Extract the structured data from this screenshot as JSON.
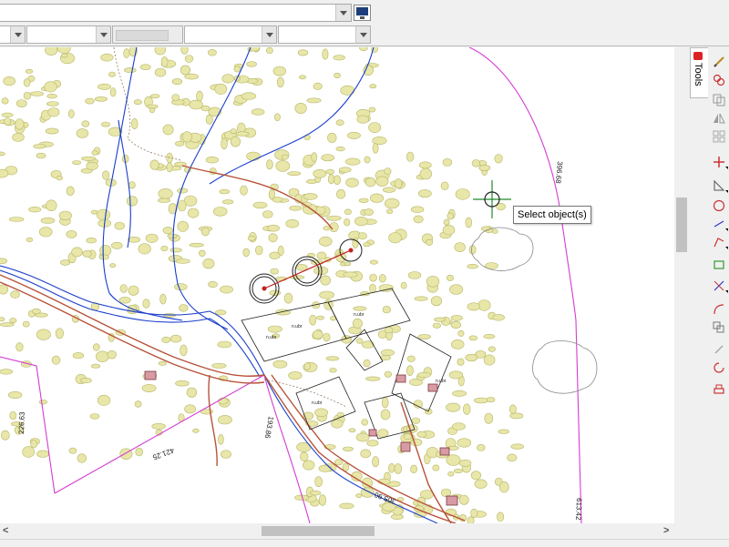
{
  "toolbar": {
    "layer_combo_value": "",
    "property_combos": [
      "",
      "",
      "",
      "",
      ""
    ]
  },
  "map": {
    "labels": {
      "dist_396": "396.68",
      "dist_226": "226.63",
      "dist_421": "421.25",
      "dist_193": "193.86",
      "dist_305": "305.90",
      "dist_613": "613.42"
    },
    "cursor_tooltip": "Select object(s)"
  },
  "side_panel": {
    "tab_label": "Tools",
    "tools": [
      "pencil-icon",
      "circle-pair-icon",
      "copy-icon",
      "mirror-icon",
      "grid-icon",
      "move-icon",
      "rectangle-corner-icon",
      "ellipse-icon",
      "line-icon",
      "polyline-icon",
      "rectangle-icon",
      "measure-icon",
      "arc-icon",
      "offset-icon",
      "pen-tool-icon",
      "rotate-icon",
      "print-icon"
    ]
  },
  "colors": {
    "property_line": "#d43cd4",
    "river": "#1a3ecb",
    "road": "#b7533a",
    "vegetation": "#e8e6a8",
    "cursor": "#1d8a2a"
  }
}
